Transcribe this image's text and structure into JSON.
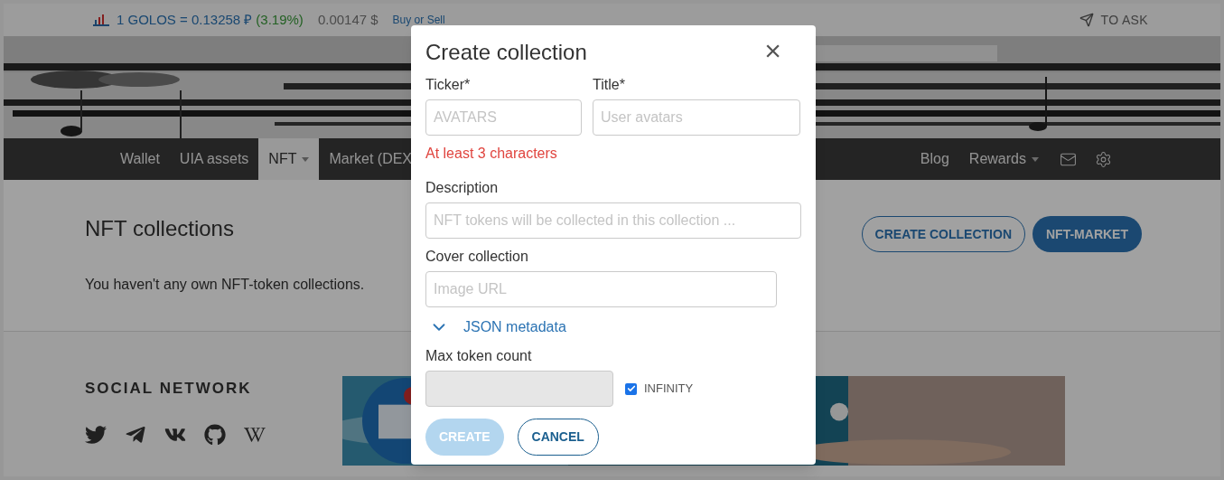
{
  "top_bar": {
    "rate": "1 GOLOS = 0.13258 ₽",
    "change": "(3.19%)",
    "usd": "0.00147 $",
    "buy_link": "Buy or Sell",
    "ask": "TO ASK"
  },
  "nav": {
    "items": [
      {
        "label": "Wallet",
        "selected": false,
        "caret": false
      },
      {
        "label": "UIA assets",
        "selected": false,
        "caret": false
      },
      {
        "label": "NFT",
        "selected": true,
        "caret": true
      },
      {
        "label": "Market (DEX",
        "selected": false,
        "caret": false
      }
    ],
    "right_items": [
      {
        "label": "Blog",
        "caret": false
      },
      {
        "label": "Rewards",
        "caret": true
      }
    ]
  },
  "content": {
    "heading": "NFT collections",
    "create_button": "CREATE COLLECTION",
    "market_button": "NFT-MARKET",
    "empty_text": "You haven't any own NFT-token collections."
  },
  "footer": {
    "heading": "SOCIAL NETWORK"
  },
  "modal": {
    "title": "Create collection",
    "close": "×",
    "ticker": {
      "label": "Ticker*",
      "placeholder": "AVATARS",
      "error": "At least 3 characters"
    },
    "title_field": {
      "label": "Title*",
      "placeholder": "User avatars"
    },
    "description": {
      "label": "Description",
      "placeholder": "NFT tokens will be collected in this collection ..."
    },
    "cover": {
      "label": "Cover collection",
      "placeholder": "Image URL"
    },
    "json_metadata": {
      "label": "JSON metadata",
      "expanded": false
    },
    "max_token": {
      "label": "Max token count",
      "disabled": true,
      "infinity": {
        "label": "INFINITY",
        "checked": true
      }
    },
    "create": {
      "label": "CREATE",
      "disabled": true
    },
    "cancel": {
      "label": "CANCEL"
    }
  }
}
